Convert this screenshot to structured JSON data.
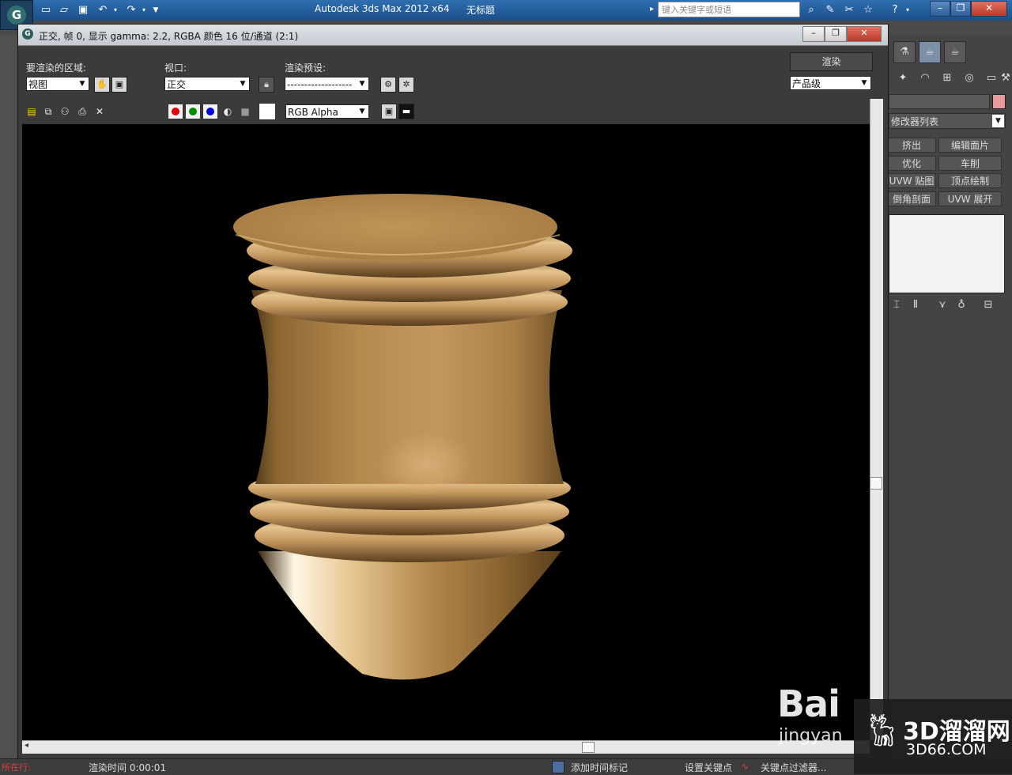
{
  "app": {
    "title": "Autodesk 3ds Max  2012 x64",
    "document": "无标题",
    "search_placeholder": "键入关键字或短语"
  },
  "render_window": {
    "title": "正交, 帧 0, 显示 gamma: 2.2, RGBA 颜色 16 位/通道 (2:1)",
    "area_label": "要渲染的区域:",
    "area_value": "视图",
    "viewport_label": "视口:",
    "viewport_value": "正交",
    "preset_label": "渲染预设:",
    "preset_value": "-------------------",
    "render_button": "渲染",
    "quality_value": "产品级",
    "channel_display": "RGB Alpha"
  },
  "command_panel": {
    "modifier_list": "修改器列表",
    "modifiers": [
      "挤出",
      "编辑面片",
      "优化",
      "车削",
      "UVW 贴图",
      "顶点绘制",
      "倒角剖面",
      "UVW 展开"
    ]
  },
  "status": {
    "location_label": "所在行:",
    "render_time": "渲染时间 0:00:01",
    "add_time_tag": "添加时间标记",
    "set_key": "设置关键点",
    "key_filters": "关键点过滤器..."
  },
  "watermark": {
    "baidu": "Bai",
    "jingyan": "jingyan",
    "site_cn": "3D溜溜网",
    "site_en": "3D66.COM"
  },
  "colors": {
    "object_body": "#b58a4f",
    "object_highlight": "#e6c48e",
    "object_shadow": "#5a3e1c",
    "canvas_bg": "#000000",
    "object_color_swatch": "#e69a9a"
  }
}
